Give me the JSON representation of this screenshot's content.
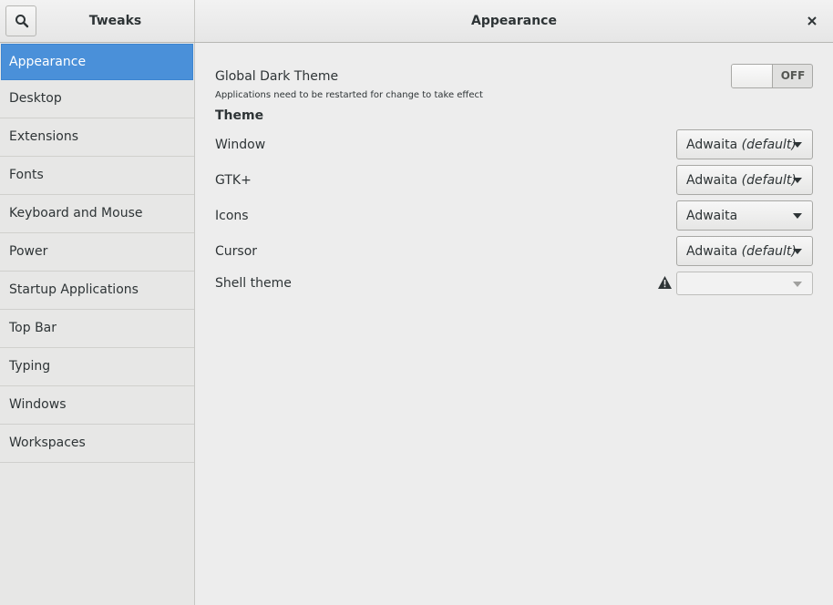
{
  "app": {
    "title": "Tweaks"
  },
  "header": {
    "title": "Appearance"
  },
  "sidebar": {
    "items": [
      {
        "label": "Appearance",
        "selected": true
      },
      {
        "label": "Desktop"
      },
      {
        "label": "Extensions"
      },
      {
        "label": "Fonts"
      },
      {
        "label": "Keyboard and Mouse"
      },
      {
        "label": "Power"
      },
      {
        "label": "Startup Applications"
      },
      {
        "label": "Top Bar"
      },
      {
        "label": "Typing"
      },
      {
        "label": "Windows"
      },
      {
        "label": "Workspaces"
      }
    ]
  },
  "main": {
    "dark_theme": {
      "label": "Global Dark Theme",
      "note": "Applications need to be restarted for change to take effect",
      "state_label": "OFF",
      "on": false
    },
    "theme_section": "Theme",
    "window": {
      "label": "Window",
      "value": "Adwaita",
      "suffix": "(default)"
    },
    "gtk": {
      "label": "GTK+",
      "value": "Adwaita",
      "suffix": "(default)"
    },
    "icons": {
      "label": "Icons",
      "value": "Adwaita"
    },
    "cursor": {
      "label": "Cursor",
      "value": "Adwaita",
      "suffix": "(default)"
    },
    "shell": {
      "label": "Shell theme",
      "value": ""
    }
  },
  "icons": {
    "search": "search-icon",
    "close": "close-icon",
    "warning": "warning-icon",
    "dropdown": "chevron-down-icon"
  },
  "colors": {
    "accent": "#4a90d9",
    "background": "#ededed",
    "sidebar": "#e7e7e6"
  }
}
